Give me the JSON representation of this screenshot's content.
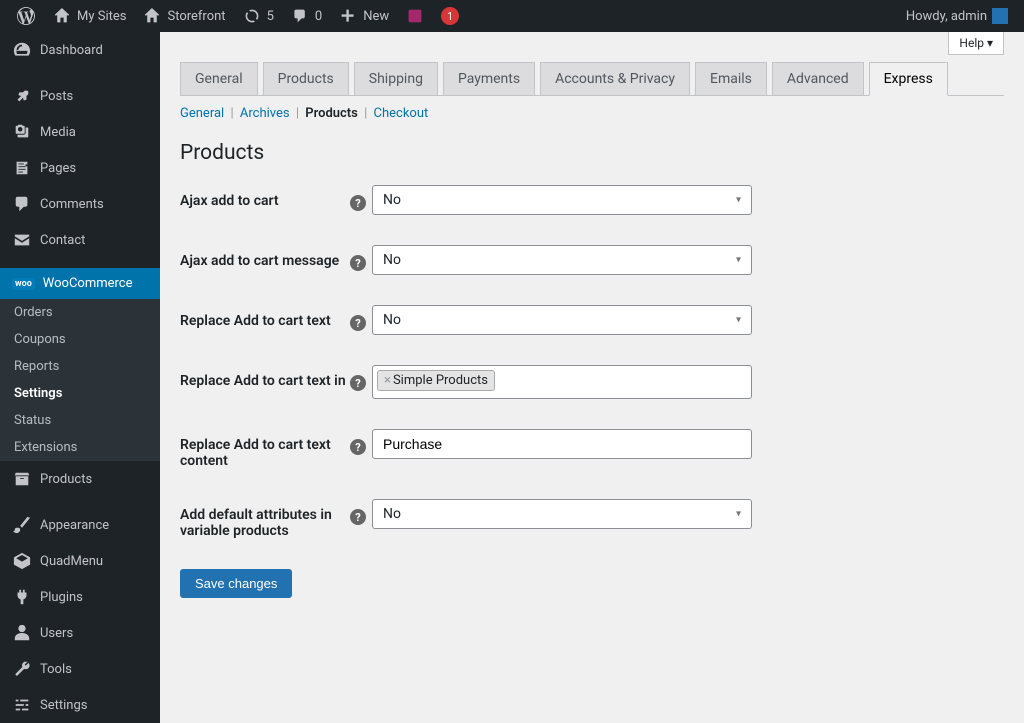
{
  "adminbar": {
    "mysites": "My Sites",
    "sitename": "Storefront",
    "updates": "5",
    "comments": "0",
    "new": "New",
    "notif": "1",
    "howdy": "Howdy, admin"
  },
  "sidebar": {
    "dashboard": "Dashboard",
    "posts": "Posts",
    "media": "Media",
    "pages": "Pages",
    "comments": "Comments",
    "contact": "Contact",
    "woocommerce": "WooCommerce",
    "sub": {
      "orders": "Orders",
      "coupons": "Coupons",
      "reports": "Reports",
      "settings": "Settings",
      "status": "Status",
      "extensions": "Extensions"
    },
    "products": "Products",
    "appearance": "Appearance",
    "quadmenu": "QuadMenu",
    "plugins": "Plugins",
    "users": "Users",
    "tools": "Tools",
    "settings_main": "Settings"
  },
  "help": "Help ▾",
  "tabs": {
    "general": "General",
    "products": "Products",
    "shipping": "Shipping",
    "payments": "Payments",
    "accounts": "Accounts & Privacy",
    "emails": "Emails",
    "advanced": "Advanced",
    "express": "Express"
  },
  "subsub": {
    "general": "General",
    "archives": "Archives",
    "products": "Products",
    "checkout": "Checkout"
  },
  "section_title": "Products",
  "fields": {
    "ajax_add": {
      "label": "Ajax add to cart",
      "value": "No"
    },
    "ajax_msg": {
      "label": "Ajax add to cart message",
      "value": "No"
    },
    "replace_text": {
      "label": "Replace Add to cart text",
      "value": "No"
    },
    "replace_in": {
      "label": "Replace Add to cart text in",
      "tag": "Simple Products"
    },
    "replace_content": {
      "label": "Replace Add to cart text content",
      "value": "Purchase"
    },
    "default_attrs": {
      "label": "Add default attributes in variable products",
      "value": "No"
    }
  },
  "save": "Save changes"
}
